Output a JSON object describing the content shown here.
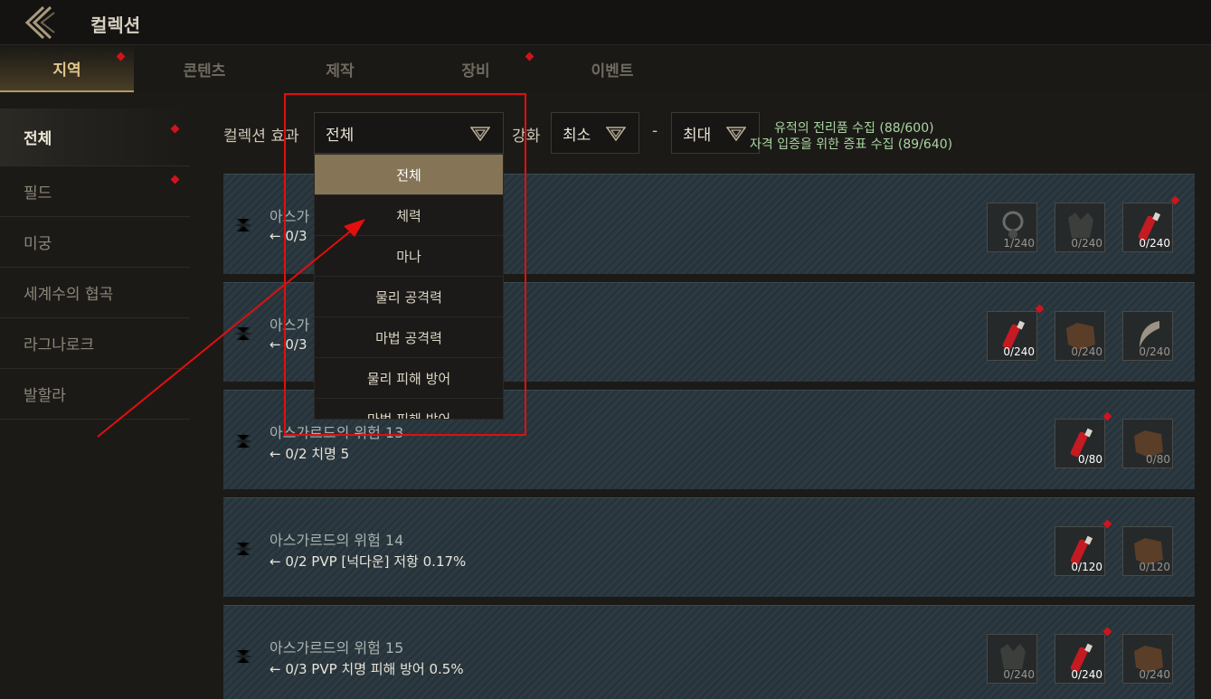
{
  "header": {
    "title": "컬렉션"
  },
  "tabs": [
    {
      "label": "지역",
      "active": true,
      "badge": true
    },
    {
      "label": "콘텐츠",
      "active": false,
      "badge": false
    },
    {
      "label": "제작",
      "active": false,
      "badge": false
    },
    {
      "label": "장비",
      "active": false,
      "badge": true
    },
    {
      "label": "이벤트",
      "active": false,
      "badge": false
    }
  ],
  "sidebar": {
    "items": [
      {
        "label": "전체",
        "active": true,
        "badge": true
      },
      {
        "label": "필드",
        "active": false,
        "badge": true
      },
      {
        "label": "미궁",
        "active": false,
        "badge": false
      },
      {
        "label": "세계수의 협곡",
        "active": false,
        "badge": false
      },
      {
        "label": "라그나로크",
        "active": false,
        "badge": false
      },
      {
        "label": "발할라",
        "active": false,
        "badge": false
      }
    ]
  },
  "filter": {
    "effect_label": "컬렉션 효과",
    "effect_value": "전체",
    "enhance_label": "강화",
    "min_value": "최소",
    "separator": "-",
    "max_value": "최대"
  },
  "progress": {
    "line1": "유적의 전리품 수집 (88/600)",
    "line2": "자격 입증을 위한 증표 수집 (89/640)"
  },
  "dropdown": {
    "options": [
      "전체",
      "체력",
      "마나",
      "물리 공격력",
      "마법 공격력",
      "물리 피해 방어",
      "마법 피해 방어"
    ],
    "selected_index": 0
  },
  "cards": [
    {
      "name": "아스가",
      "effect": "0/3",
      "slots": [
        {
          "icon": "necklace-icon",
          "count": "1/240",
          "have": false,
          "badge": false
        },
        {
          "icon": "wolf-pelt-icon",
          "count": "0/240",
          "have": false,
          "badge": false
        },
        {
          "icon": "red-potion-icon",
          "count": "0/240",
          "have": true,
          "badge": true
        }
      ]
    },
    {
      "name": "아스가",
      "effect": "0/3",
      "slots": [
        {
          "icon": "red-potion-icon",
          "count": "0/240",
          "have": true,
          "badge": true
        },
        {
          "icon": "leather-icon",
          "count": "0/240",
          "have": false,
          "badge": false
        },
        {
          "icon": "horn-icon",
          "count": "0/240",
          "have": false,
          "badge": false
        }
      ]
    },
    {
      "name": "아스가르드의 위험 13",
      "effect": "0/2 치명 5",
      "slots": [
        {
          "icon": "red-potion-icon",
          "count": "0/80",
          "have": true,
          "badge": true
        },
        {
          "icon": "leather-icon",
          "count": "0/80",
          "have": false,
          "badge": false
        }
      ]
    },
    {
      "name": "아스가르드의 위험 14",
      "effect": "0/2 PVP [넉다운] 저항 0.17%",
      "slots": [
        {
          "icon": "red-potion-icon",
          "count": "0/120",
          "have": true,
          "badge": true
        },
        {
          "icon": "leather-icon",
          "count": "0/120",
          "have": false,
          "badge": false
        }
      ]
    },
    {
      "name": "아스가르드의 위험 15",
      "effect": "0/3 PVP 치명 피해 방어 0.5%",
      "slots": [
        {
          "icon": "wolf-pelt-icon",
          "count": "0/240",
          "have": false,
          "badge": false
        },
        {
          "icon": "red-potion-icon",
          "count": "0/240",
          "have": true,
          "badge": true
        },
        {
          "icon": "leather-icon",
          "count": "0/240",
          "have": false,
          "badge": false
        }
      ]
    }
  ],
  "colors": {
    "accent_gold": "#e2c78c",
    "badge_red": "#d0141c",
    "progress_green": "#a9d6a2",
    "annotation_red": "#e10f0f"
  }
}
